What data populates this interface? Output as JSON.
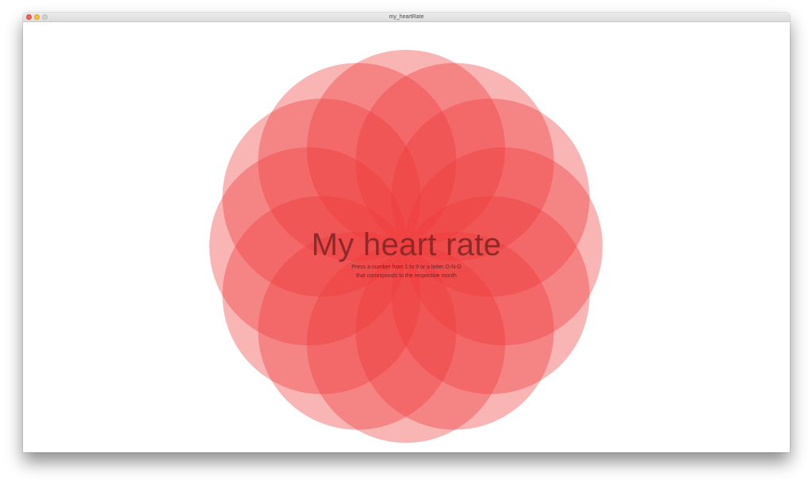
{
  "window": {
    "title": "my_heartRate"
  },
  "content": {
    "headline": "My heart rate",
    "instructions_line1": "Press a number from 1 to 9 or a letter O-N-D",
    "instructions_line2": "that corresponds to the respective month"
  },
  "rosette": {
    "petal_count": 12,
    "color": "#ef3b3b",
    "petal_opacity": 0.38
  }
}
